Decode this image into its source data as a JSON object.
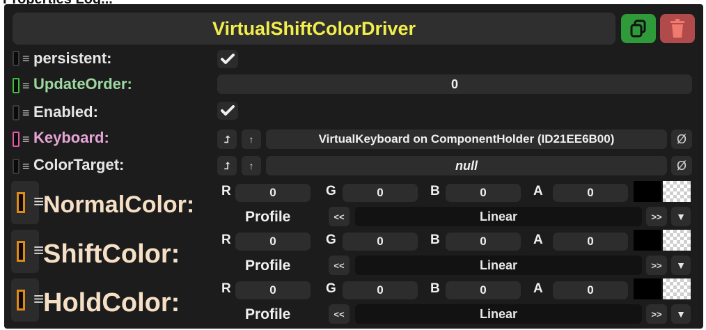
{
  "window": {
    "partial_title": "Properties Log..."
  },
  "component": {
    "title": "VirtualShiftColorDriver",
    "duplicate_icon": "duplicate-icon",
    "delete_icon": "trash-icon"
  },
  "fields": {
    "persistent": {
      "label": "persistent:",
      "checked": true
    },
    "update_order": {
      "label": "UpdateOrder:",
      "value": "0"
    },
    "enabled": {
      "label": "Enabled:",
      "checked": true
    },
    "keyboard": {
      "label": "Keyboard:",
      "value": "VirtualKeyboard on ComponentHolder (ID21EE6B00)",
      "null_symbol": "Ø"
    },
    "color_target": {
      "label": "ColorTarget:",
      "value": "null",
      "null_symbol": "Ø"
    }
  },
  "colors": [
    {
      "label": "NormalColor:",
      "r": "0",
      "g": "0",
      "b": "0",
      "a": "0",
      "profile_label": "Profile",
      "profile": "Linear"
    },
    {
      "label": "ShiftColor:",
      "r": "0",
      "g": "0",
      "b": "0",
      "a": "0",
      "profile_label": "Profile",
      "profile": "Linear"
    },
    {
      "label": "HoldColor:",
      "r": "0",
      "g": "0",
      "b": "0",
      "a": "0",
      "profile_label": "Profile",
      "profile": "Linear"
    }
  ],
  "channel_labels": {
    "r": "R",
    "g": "G",
    "b": "B",
    "a": "A"
  },
  "buttons": {
    "jump": "⮥",
    "up": "↑",
    "prev": "<<",
    "next": ">>",
    "dropdown": "▼"
  },
  "theme": {
    "title_color": "#f2ee4c",
    "update_order_color": "#9ed8a0",
    "keyboard_color": "#e7a4d6",
    "color_label": "#f5dfc5",
    "duplicate_bg": "#2f9a3a",
    "delete_bg": "#b14b4b"
  }
}
